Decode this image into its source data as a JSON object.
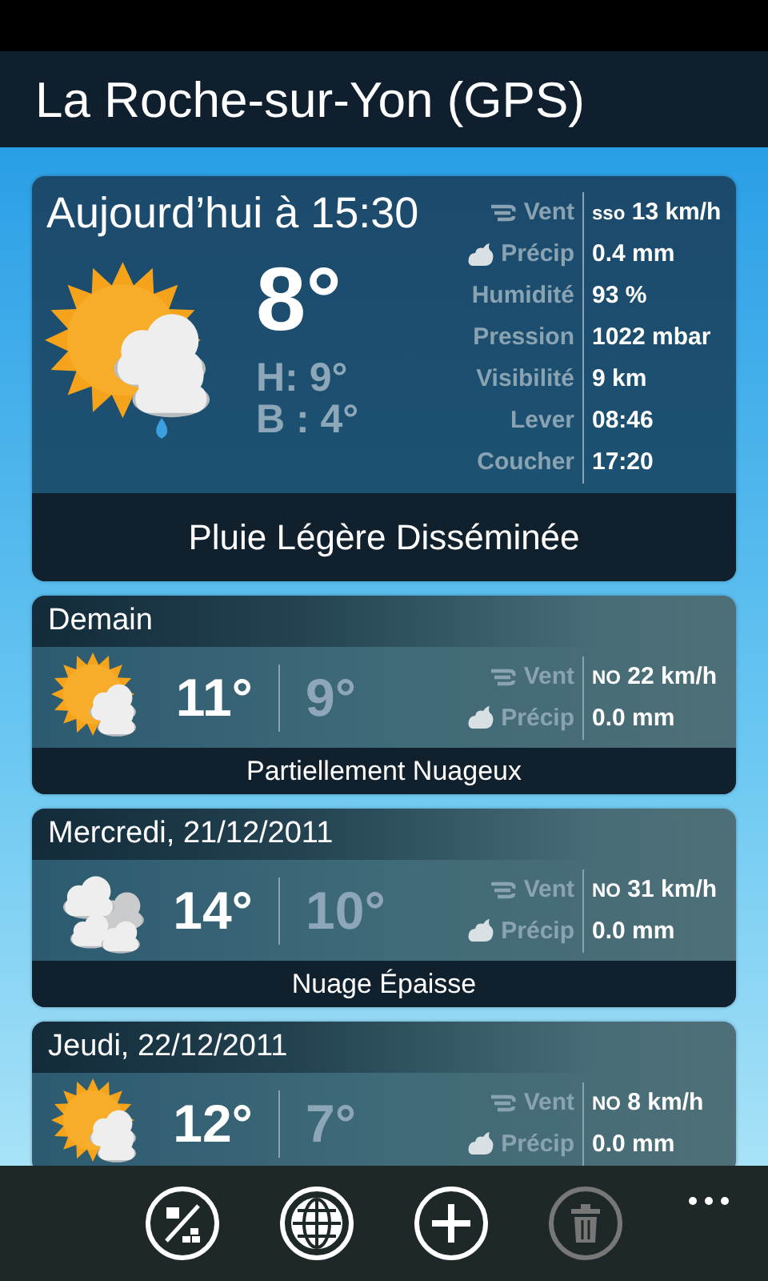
{
  "title": "La Roche-sur-Yon (GPS)",
  "today": {
    "heading": "Aujourd’hui à 15:30",
    "kind": "sun-cloud-rain",
    "temp": "8°",
    "high": "H: 9°",
    "low": "B : 4°",
    "details": [
      {
        "kind": "wind",
        "label": "Vent",
        "direction": "sso",
        "value": "13 km/h"
      },
      {
        "kind": "precip",
        "label": "Précip",
        "value": "0.4 mm"
      },
      {
        "kind": "plain",
        "label": "Humidité",
        "value": "93 %"
      },
      {
        "kind": "plain",
        "label": "Pression",
        "value": "1022 mbar"
      },
      {
        "kind": "plain",
        "label": "Visibilité",
        "value": "9 km"
      },
      {
        "kind": "plain",
        "label": "Lever",
        "value": "08:46"
      },
      {
        "kind": "plain",
        "label": "Coucher",
        "value": "17:20"
      }
    ],
    "summary": "Pluie Légère Disséminée"
  },
  "forecast": [
    {
      "day": "Demain",
      "kind": "sun-cloud",
      "high": "11°",
      "low": "9°",
      "details": [
        {
          "kind": "wind",
          "label": "Vent",
          "direction": "NO",
          "value": "22 km/h"
        },
        {
          "kind": "precip",
          "label": "Précip",
          "value": "0.0 mm"
        }
      ],
      "summary": "Partiellement Nuageux"
    },
    {
      "day": "Mercredi, 21/12/2011",
      "kind": "clouds",
      "high": "14°",
      "low": "10°",
      "details": [
        {
          "kind": "wind",
          "label": "Vent",
          "direction": "NO",
          "value": "31 km/h"
        },
        {
          "kind": "precip",
          "label": "Précip",
          "value": "0.0 mm"
        }
      ],
      "summary": "Nuage Épaisse"
    },
    {
      "day": "Jeudi, 22/12/2011",
      "kind": "sun-cloud",
      "high": "12°",
      "low": "7°",
      "details": [
        {
          "kind": "wind",
          "label": "Vent",
          "direction": "NO",
          "value": "8 km/h"
        },
        {
          "kind": "precip",
          "label": "Précip",
          "value": "0.0 mm"
        }
      ]
    }
  ],
  "app_bar": {
    "buttons": [
      {
        "kind": "units",
        "disabled": false
      },
      {
        "kind": "globe",
        "disabled": false
      },
      {
        "kind": "add",
        "disabled": false
      },
      {
        "kind": "delete",
        "disabled": true
      }
    ]
  }
}
